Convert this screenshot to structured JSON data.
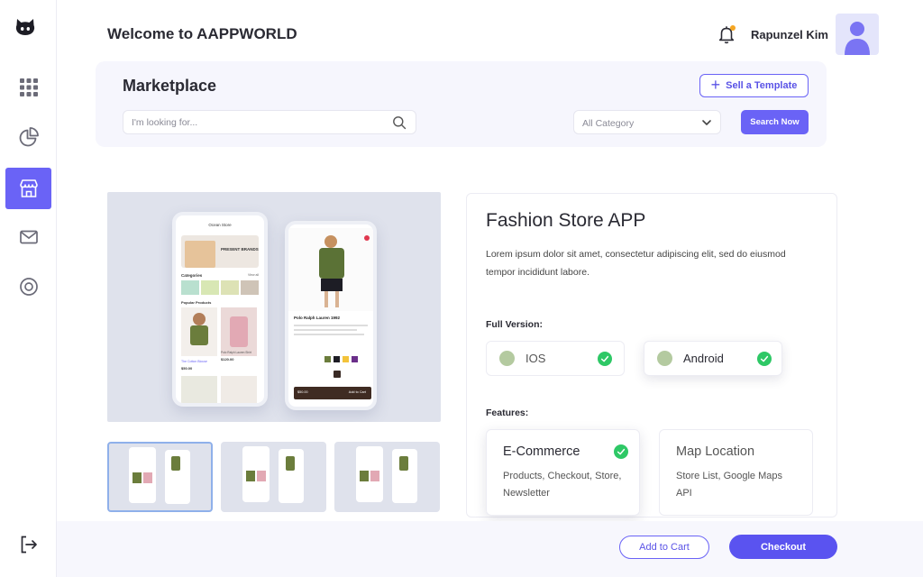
{
  "header": {
    "title": "Welcome to AAPPWORLD",
    "user_name": "Rapunzel Kim"
  },
  "sidebar": {
    "items": [
      {
        "icon": "grid-icon",
        "active": false
      },
      {
        "icon": "pie-chart-icon",
        "active": false
      },
      {
        "icon": "store-icon",
        "active": true
      },
      {
        "icon": "mail-icon",
        "active": false
      },
      {
        "icon": "settings-circle-icon",
        "active": false
      }
    ],
    "logout_icon": "logout-icon"
  },
  "marketplace": {
    "title": "Marketplace",
    "sell_button": "Sell a Template",
    "search_placeholder": "I'm looking for...",
    "category_value": "All Category",
    "search_button": "Search Now"
  },
  "preview": {
    "phone_left": {
      "store_name": "Ocean Store",
      "banner": "PRESENT BRANDS",
      "categories_label": "Categories",
      "view_all": "View all",
      "popular_label": "Popular Products",
      "product_name": "The Cotton Blouse",
      "product_price": "$50.00",
      "product2_name": "Polo Ralph Lauren Shirt",
      "product2_price": "$120.00"
    },
    "phone_right": {
      "product_title": "Polo Ralph Lauren 1992",
      "price": "$50.00",
      "add_to_cart": "Add to Cart"
    },
    "selected_thumb": 0
  },
  "product": {
    "title": "Fashion Store APP",
    "description": "Lorem ipsum dolor sit amet, consectetur adipiscing elit, sed do eiusmod tempor incididunt labore.",
    "full_version_label": "Full Version:",
    "versions": [
      {
        "label": "IOS",
        "checked": true
      },
      {
        "label": "Android",
        "checked": true
      }
    ],
    "features_label": "Features:",
    "features": [
      {
        "title": "E-Commerce",
        "desc": "Products, Checkout, Store, Newsletter",
        "checked": true
      },
      {
        "title": "Map Location",
        "desc": "Store List, Google Maps API",
        "checked": false
      }
    ]
  },
  "footer": {
    "add_to_cart": "Add to Cart",
    "checkout": "Checkout"
  },
  "colors": {
    "accent": "#6a63f6",
    "check": "#2ec866",
    "notification_dot": "#f5a623"
  }
}
